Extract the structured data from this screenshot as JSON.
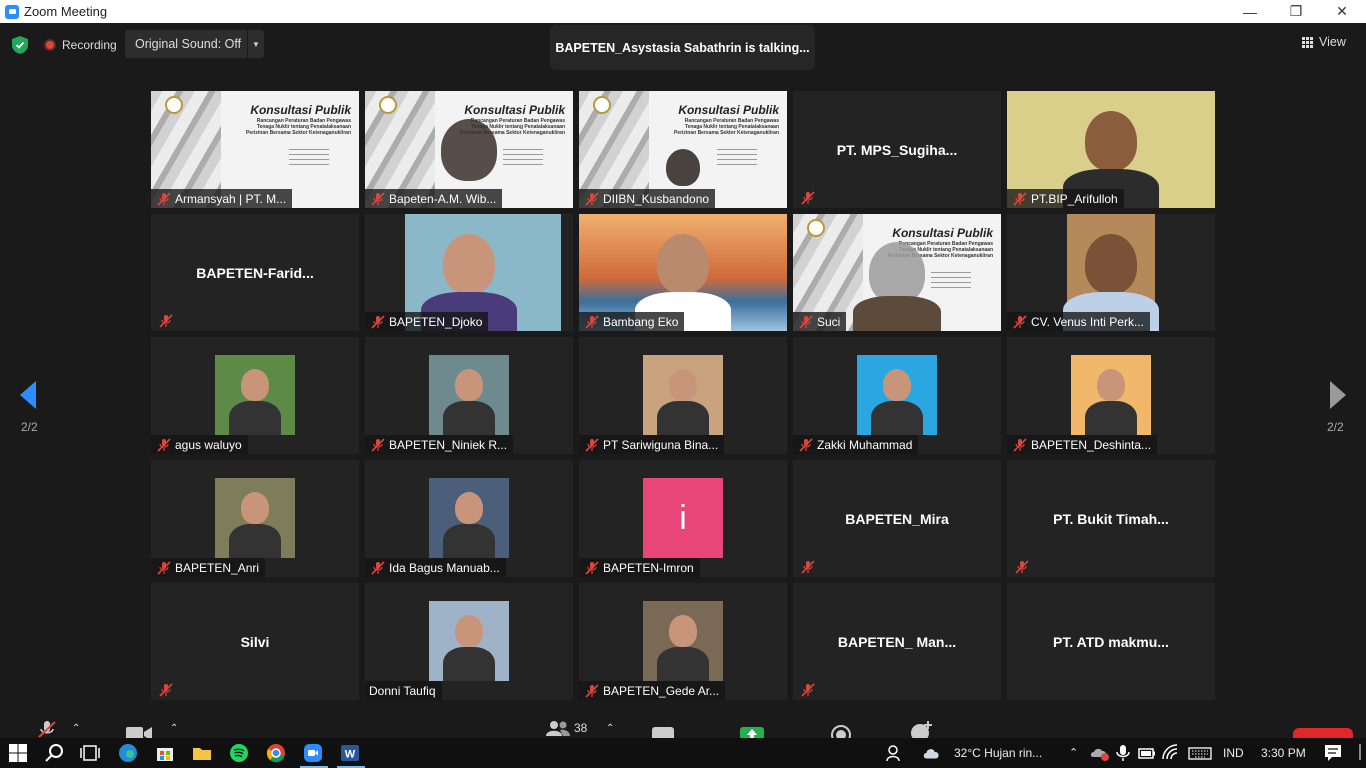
{
  "window": {
    "title": "Zoom Meeting"
  },
  "topbar": {
    "recording_label": "Recording",
    "original_sound_label": "Original Sound: Off",
    "talking_indicator": "BAPETEN_Asystasia Sabathrin is talking...",
    "view_label": "View"
  },
  "pagination": {
    "left": "2/2",
    "right": "2/2"
  },
  "participants": [
    {
      "name": "Armansyah | PT. M...",
      "kind": "slide",
      "muted": true
    },
    {
      "name": "Bapeten-A.M. Wib...",
      "kind": "slide",
      "muted": true
    },
    {
      "name": "DIIBN_Kusbandono",
      "kind": "slide",
      "muted": true
    },
    {
      "name": "PT.  MPS_Sugiha...",
      "kind": "name-only",
      "muted": true
    },
    {
      "name": "PT.BIP_Arifulloh",
      "kind": "video",
      "muted": true
    },
    {
      "name": "BAPETEN-Farid...",
      "kind": "name-only",
      "muted": true
    },
    {
      "name": "BAPETEN_Djoko",
      "kind": "video",
      "muted": true
    },
    {
      "name": "Bambang Eko",
      "kind": "video",
      "muted": true
    },
    {
      "name": "Suci",
      "kind": "slide",
      "muted": true
    },
    {
      "name": "CV. Venus Inti Perk...",
      "kind": "video",
      "muted": true
    },
    {
      "name": "agus waluyo",
      "kind": "photo",
      "muted": true
    },
    {
      "name": "BAPETEN_Niniek R...",
      "kind": "photo",
      "muted": true
    },
    {
      "name": "PT Sariwiguna Bina...",
      "kind": "photo",
      "muted": true
    },
    {
      "name": "Zakki Muhammad",
      "kind": "photo",
      "muted": true
    },
    {
      "name": "BAPETEN_Deshinta...",
      "kind": "photo",
      "muted": true
    },
    {
      "name": "BAPETEN_Anri",
      "kind": "photo",
      "muted": true
    },
    {
      "name": "Ida Bagus Manuab...",
      "kind": "photo",
      "muted": true
    },
    {
      "name": "BAPETEN-Imron",
      "kind": "initial",
      "initial": "i",
      "muted": true
    },
    {
      "name": "BAPETEN_Mira",
      "kind": "name-only",
      "muted": true
    },
    {
      "name": "PT. Bukit Timah...",
      "kind": "name-only",
      "muted": true
    },
    {
      "name": "Silvi",
      "kind": "name-only",
      "muted": true
    },
    {
      "name": "Donni Taufiq",
      "kind": "photo",
      "muted": false
    },
    {
      "name": "BAPETEN_Gede Ar...",
      "kind": "photo",
      "muted": true
    },
    {
      "name": "BAPETEN_  Man...",
      "kind": "name-only",
      "muted": true
    },
    {
      "name": "PT. ATD makmu...",
      "kind": "name-only",
      "muted": false
    }
  ],
  "slide": {
    "title": "Konsultasi Publik",
    "subtitle": "Rancangan Peraturan Badan Pengawas Tenaga Nuklir tentang Penatalaksanaan Perizinan Bersama Sektor Ketenaganukliran",
    "date": "23 Juni 2021"
  },
  "toolbar": {
    "participants_count": "38"
  },
  "taskbar": {
    "weather": "32°C  Hujan rin...",
    "language": "IND",
    "time": "3:30 PM"
  },
  "colors": {
    "accent": "#2d8cff",
    "muted_icon": "#e0453b",
    "end_button": "#e02828",
    "initial_bg": "#e8457a"
  }
}
